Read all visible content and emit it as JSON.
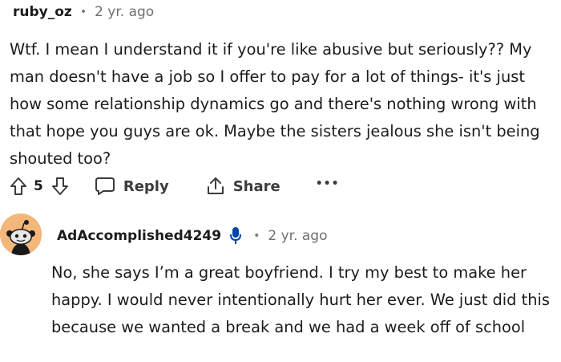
{
  "comment1": {
    "username": "ruby_oz",
    "separator": "•",
    "time": "2 yr. ago",
    "body": "Wtf. I mean I understand it if you're like abusive but seriously?? My man doesn't have a job so I offer to pay for a lot of things- it's just how some relationship dynamics go and there's nothing wrong with that hope you guys are ok. Maybe the sisters jealous she isn't being shouted too?",
    "votes": "5",
    "reply_label": "Reply",
    "share_label": "Share",
    "more_label": "•••"
  },
  "comment2": {
    "username": "AdAccomplished4249",
    "separator": "•",
    "time": "2 yr. ago",
    "body": "No, she says I’m a great boyfriend. I try my best to make her happy. I would never intentionally hurt her ever. We just did this because we wanted a break and we had a week off of school",
    "avatar_icon": "snoo-avatar-icon",
    "badge_icon": "microphone-icon"
  },
  "colors": {
    "avatar_bg": "#f3b77a",
    "badge": "#0045ac",
    "text": "#1c1c1c",
    "meta": "#6f6f6f"
  }
}
